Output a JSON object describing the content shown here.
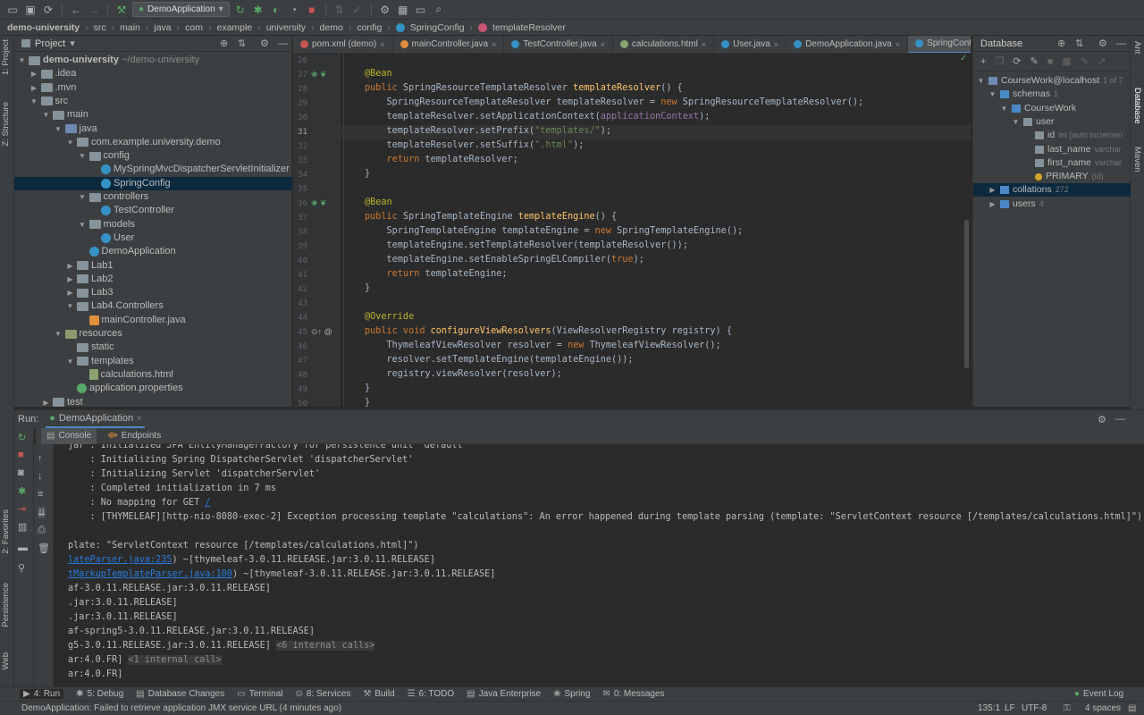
{
  "toolbar": {
    "run_config": "DemoApplication"
  },
  "breadcrumb": [
    "demo-university",
    "src",
    "main",
    "java",
    "com",
    "example",
    "university",
    "demo",
    "config",
    "SpringConfig",
    "templateResolver"
  ],
  "left_strip": {
    "project": "1: Project",
    "structure": "Z: Structure",
    "favorites": "2: Favorites",
    "persistence": "Persistence",
    "web": "Web"
  },
  "right_strip": {
    "ant": "Ant",
    "database": "Database",
    "maven": "Maven"
  },
  "project": {
    "title": "Project",
    "tree": [
      {
        "label": "demo-university",
        "extra": "~/demo-university",
        "depth": 0,
        "arrow": "▼",
        "icon": "folder-icon",
        "bold": true
      },
      {
        "label": ".idea",
        "depth": 1,
        "arrow": "▶",
        "icon": "folder-icon"
      },
      {
        "label": ".mvn",
        "depth": 1,
        "arrow": "▶",
        "icon": "folder-icon"
      },
      {
        "label": "src",
        "depth": 1,
        "arrow": "▼",
        "icon": "folder-icon"
      },
      {
        "label": "main",
        "depth": 2,
        "arrow": "▼",
        "icon": "folder-icon"
      },
      {
        "label": "java",
        "depth": 3,
        "arrow": "▼",
        "icon": "source-folder-icon"
      },
      {
        "label": "com.example.university.demo",
        "depth": 4,
        "arrow": "▼",
        "icon": "package-icon"
      },
      {
        "label": "config",
        "depth": 5,
        "arrow": "▼",
        "icon": "package-icon"
      },
      {
        "label": "MySpringMvcDispatcherServletInitializer",
        "depth": 6,
        "arrow": "",
        "icon": "class-icon"
      },
      {
        "label": "SpringConfig",
        "depth": 6,
        "arrow": "",
        "icon": "class-icon",
        "selected": true
      },
      {
        "label": "controllers",
        "depth": 5,
        "arrow": "▼",
        "icon": "package-icon"
      },
      {
        "label": "TestController",
        "depth": 6,
        "arrow": "",
        "icon": "class-icon"
      },
      {
        "label": "models",
        "depth": 5,
        "arrow": "▼",
        "icon": "package-icon"
      },
      {
        "label": "User",
        "depth": 6,
        "arrow": "",
        "icon": "class-icon"
      },
      {
        "label": "DemoApplication",
        "depth": 5,
        "arrow": "",
        "icon": "spring-class-icon"
      },
      {
        "label": "Lab1",
        "depth": 4,
        "arrow": "▶",
        "icon": "package-icon"
      },
      {
        "label": "Lab2",
        "depth": 4,
        "arrow": "▶",
        "icon": "package-icon"
      },
      {
        "label": "Lab3",
        "depth": 4,
        "arrow": "▶",
        "icon": "package-icon"
      },
      {
        "label": "Lab4.Controllers",
        "depth": 4,
        "arrow": "▼",
        "icon": "package-icon"
      },
      {
        "label": "mainController.java",
        "depth": 5,
        "arrow": "",
        "icon": "java-file-icon"
      },
      {
        "label": "resources",
        "depth": 3,
        "arrow": "▼",
        "icon": "resources-folder-icon"
      },
      {
        "label": "static",
        "depth": 4,
        "arrow": "",
        "icon": "folder-icon"
      },
      {
        "label": "templates",
        "depth": 4,
        "arrow": "▼",
        "icon": "folder-icon"
      },
      {
        "label": "calculations.html",
        "depth": 5,
        "arrow": "",
        "icon": "html-file-icon"
      },
      {
        "label": "application.properties",
        "depth": 4,
        "arrow": "",
        "icon": "properties-file-icon"
      },
      {
        "label": "test",
        "depth": 2,
        "arrow": "▶",
        "icon": "folder-icon"
      }
    ]
  },
  "tabs": [
    {
      "label": "pom.xml (demo)",
      "icon": "maven-icon"
    },
    {
      "label": "mainController.java",
      "icon": "java-file-icon"
    },
    {
      "label": "TestController.java",
      "icon": "class-icon"
    },
    {
      "label": "calculations.html",
      "icon": "html-file-icon"
    },
    {
      "label": "User.java",
      "icon": "class-icon"
    },
    {
      "label": "DemoApplication.java",
      "icon": "class-icon"
    },
    {
      "label": "SpringConfig.java",
      "icon": "class-icon",
      "active": true
    }
  ],
  "editor": {
    "current_line": "31",
    "lines": [
      {
        "n": "26",
        "html": ""
      },
      {
        "n": "27",
        "html": "<span class=\"an\">@Bean</span>",
        "gutter": "bean"
      },
      {
        "n": "28",
        "html": "<span class=\"kw\">public</span> SpringResourceTemplateResolver <span class=\"fn\">templateResolver</span>() {"
      },
      {
        "n": "29",
        "html": "    SpringResourceTemplateResolver templateResolver = <span class=\"kw\">new</span> SpringResourceTemplateResolver();"
      },
      {
        "n": "30",
        "html": "    templateResolver.setApplicationContext(<span class=\"fld\">applicationContext</span>);"
      },
      {
        "n": "31",
        "html": "    templateResolver.setPrefix(<span class=\"st\">\"templates/\"</span>);"
      },
      {
        "n": "32",
        "html": "    templateResolver.setSuffix(<span class=\"st\">\".html\"</span>);"
      },
      {
        "n": "33",
        "html": "    <span class=\"kw\">return</span> templateResolver;"
      },
      {
        "n": "34",
        "html": "}"
      },
      {
        "n": "35",
        "html": ""
      },
      {
        "n": "36",
        "html": "<span class=\"an\">@Bean</span>",
        "gutter": "bean"
      },
      {
        "n": "37",
        "html": "<span class=\"kw\">public</span> SpringTemplateEngine <span class=\"fn\">templateEngine</span>() {"
      },
      {
        "n": "38",
        "html": "    SpringTemplateEngine templateEngine = <span class=\"kw\">new</span> SpringTemplateEngine();"
      },
      {
        "n": "39",
        "html": "    templateEngine.setTemplateResolver(templateResolver());"
      },
      {
        "n": "40",
        "html": "    templateEngine.setEnableSpringELCompiler(<span class=\"kw\">true</span>);"
      },
      {
        "n": "41",
        "html": "    <span class=\"kw\">return</span> templateEngine;"
      },
      {
        "n": "42",
        "html": "}"
      },
      {
        "n": "43",
        "html": ""
      },
      {
        "n": "44",
        "html": "<span class=\"an\">@Override</span>"
      },
      {
        "n": "45",
        "html": "<span class=\"kw\">public void</span> <span class=\"fn\">configureViewResolvers</span>(ViewResolverRegistry registry) {",
        "gutter": "override"
      },
      {
        "n": "46",
        "html": "    ThymeleafViewResolver resolver = <span class=\"kw\">new</span> ThymeleafViewResolver();"
      },
      {
        "n": "47",
        "html": "    resolver.setTemplateEngine(templateEngine());"
      },
      {
        "n": "48",
        "html": "    registry.viewResolver(resolver);"
      },
      {
        "n": "49",
        "html": "}"
      },
      {
        "n": "50",
        "html": "}"
      }
    ]
  },
  "database": {
    "title": "Database",
    "rows": [
      {
        "label": "CourseWork@localhost",
        "extra": "1 of 7",
        "depth": 0,
        "arrow": "▼",
        "icon": "datasource-icon"
      },
      {
        "label": "schemas",
        "extra": "1",
        "depth": 1,
        "arrow": "▼",
        "icon": "folder-icon"
      },
      {
        "label": "CourseWork",
        "depth": 2,
        "arrow": "▼",
        "icon": "schema-icon"
      },
      {
        "label": "user",
        "depth": 3,
        "arrow": "▼",
        "icon": "table-icon"
      },
      {
        "label": "id",
        "extra": "int (auto incremen",
        "depth": 4,
        "arrow": "",
        "icon": "column-icon"
      },
      {
        "label": "last_name",
        "extra": "varchar",
        "depth": 4,
        "arrow": "",
        "icon": "column-icon"
      },
      {
        "label": "first_name",
        "extra": "varchar",
        "depth": 4,
        "arrow": "",
        "icon": "column-icon"
      },
      {
        "label": "PRIMARY",
        "extra": "(id)",
        "depth": 4,
        "arrow": "",
        "icon": "key-icon"
      },
      {
        "label": "collations",
        "extra": "272",
        "depth": 1,
        "arrow": "▶",
        "icon": "folder-icon",
        "selected": true
      },
      {
        "label": "users",
        "extra": "4",
        "depth": 1,
        "arrow": "▶",
        "icon": "folder-icon"
      }
    ]
  },
  "run": {
    "label": "Run:",
    "config": "DemoApplication",
    "tabs": [
      "Console",
      "Endpoints"
    ],
    "console": [
      {
        "html": "jar : Initialized JPA EntityManagerFactory for persistence unit 'default'"
      },
      {
        "html": "    : Initializing Spring DispatcherServlet 'dispatcherServlet'"
      },
      {
        "html": "    : Initializing Servlet 'dispatcherServlet'"
      },
      {
        "html": "    : Completed initialization in 7 ms"
      },
      {
        "html": "    : No mapping for GET <span class=\"lnk\">/</span>"
      },
      {
        "html": "    : [THYMELEAF][http-nio-8080-exec-2] Exception processing template \"calculations\": An error happened during template parsing (template: \"ServletContext resource [/templates/calculations.html]\")"
      },
      {
        "html": ""
      },
      {
        "html": "plate: \"ServletContext resource [/templates/calculations.html]\")"
      },
      {
        "html": "<span class=\"lnk\">lateParser.java:235</span>) ~[thymeleaf-3.0.11.RELEASE.jar:3.0.11.RELEASE]"
      },
      {
        "html": "<span class=\"lnk\">tMarkupTemplateParser.java:100</span>) ~[thymeleaf-3.0.11.RELEASE.jar:3.0.11.RELEASE]"
      },
      {
        "html": "af-3.0.11.RELEASE.jar:3.0.11.RELEASE]"
      },
      {
        "html": ".jar:3.0.11.RELEASE]"
      },
      {
        "html": ".jar:3.0.11.RELEASE]"
      },
      {
        "html": "af-spring5-3.0.11.RELEASE.jar:3.0.11.RELEASE]"
      },
      {
        "html": "g5-3.0.11.RELEASE.jar:3.0.11.RELEASE] <span class=\"gray\">&lt;6 internal calls&gt;</span>"
      },
      {
        "html": "ar:4.0.FR] <span class=\"gray\">&lt;1 internal call&gt;</span>"
      },
      {
        "html": "ar:4.0.FR]"
      }
    ]
  },
  "bottom_tools": [
    {
      "label": "4: Run",
      "icon": "run-icon",
      "active": true
    },
    {
      "label": "5: Debug",
      "icon": "debug-icon"
    },
    {
      "label": "Database Changes",
      "icon": "database-changes-icon"
    },
    {
      "label": "Terminal",
      "icon": "terminal-icon"
    },
    {
      "label": "8: Services",
      "icon": "services-icon"
    },
    {
      "label": "Build",
      "icon": "build-icon"
    },
    {
      "label": "6: TODO",
      "icon": "todo-icon"
    },
    {
      "label": "Java Enterprise",
      "icon": "java-enterprise-icon"
    },
    {
      "label": "Spring",
      "icon": "spring-icon"
    },
    {
      "label": "0: Messages",
      "icon": "messages-icon"
    }
  ],
  "event_log": "Event Log",
  "status": {
    "message": "DemoApplication: Failed to retrieve application JMX service URL (4 minutes ago)",
    "position": "135:1",
    "line_sep": "LF",
    "encoding": "UTF-8",
    "indent": "4 spaces"
  }
}
